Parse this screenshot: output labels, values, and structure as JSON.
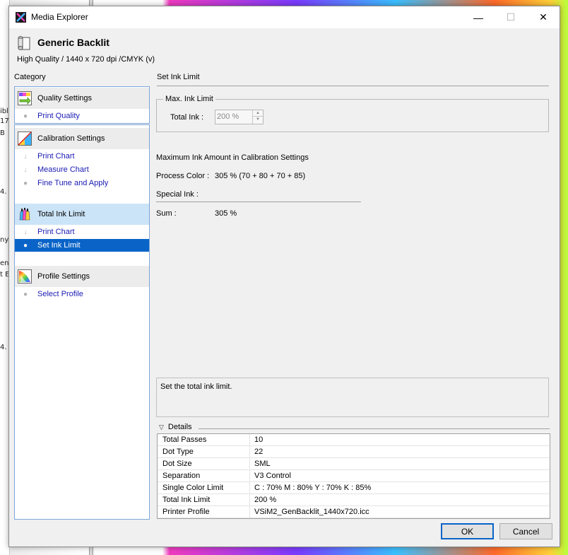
{
  "window": {
    "title": "Media Explorer",
    "controls": {
      "minimize": "—",
      "maximize": "☐",
      "close": "✕"
    }
  },
  "media": {
    "name": "Generic Backlit",
    "subtitle": "High Quality / 1440 x 720 dpi /CMYK (v)"
  },
  "category": {
    "label": "Category",
    "groups": [
      {
        "label": "Quality Settings",
        "icon": "quality-settings-icon",
        "items": [
          {
            "label": "Print Quality",
            "marker": "dot"
          }
        ]
      },
      {
        "label": "Calibration Settings",
        "icon": "calibration-settings-icon",
        "items": [
          {
            "label": "Print Chart",
            "marker": "arrow"
          },
          {
            "label": "Measure Chart",
            "marker": "arrow"
          },
          {
            "label": "Fine Tune and Apply",
            "marker": "dot"
          }
        ]
      },
      {
        "label": "Total Ink Limit",
        "icon": "total-ink-limit-icon",
        "selected": true,
        "items": [
          {
            "label": "Print Chart",
            "marker": "arrow"
          },
          {
            "label": "Set Ink Limit",
            "marker": "dot",
            "active": true
          }
        ]
      },
      {
        "label": "Profile Settings",
        "icon": "profile-settings-icon",
        "items": [
          {
            "label": "Select Profile",
            "marker": "dot"
          }
        ]
      }
    ]
  },
  "main": {
    "section_title": "Set Ink Limit",
    "max_ink_group": "Max. Ink Limit",
    "total_ink_label": "Total Ink :",
    "total_ink_value": "200 %",
    "calib_heading": "Maximum Ink Amount in Calibration Settings",
    "process_color_label": "Process Color :",
    "process_color_value": "305 % (70 + 80 + 70 + 85)",
    "special_ink_label": "Special Ink :",
    "sum_label": "Sum :",
    "sum_value": "305 %",
    "description": "Set the total ink limit."
  },
  "details": {
    "label": "Details",
    "rows": [
      {
        "key": "Total Passes",
        "value": "10"
      },
      {
        "key": "Dot Type",
        "value": "22"
      },
      {
        "key": "Dot Size",
        "value": "SML"
      },
      {
        "key": "Separation",
        "value": "V3 Control"
      },
      {
        "key": "Single Color Limit",
        "value": "C : 70% M : 80% Y : 70% K : 85%"
      },
      {
        "key": "Total Ink Limit",
        "value": "200 %"
      },
      {
        "key": "Printer Profile",
        "value": "VSiM2_GenBacklit_1440x720.icc"
      }
    ]
  },
  "buttons": {
    "ok": "OK",
    "cancel": "Cancel"
  },
  "background_fragments": [
    "ibl",
    "17",
    "B",
    "4.",
    "ny",
    "en",
    "t E",
    "4."
  ],
  "colors": {
    "accent": "#0a64c8",
    "link": "#1a1ab4",
    "group_selected": "#cce4f7"
  }
}
